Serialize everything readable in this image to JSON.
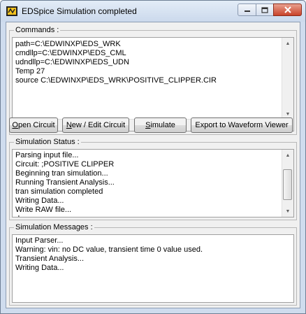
{
  "window": {
    "title": "EDSpice Simulation completed"
  },
  "commands": {
    "label": "Commands :",
    "lines": [
      "path=C:\\EDWINXP\\EDS_WRK",
      "cmdllp=C:\\EDWINXP\\EDS_CML",
      "udndllp=C:\\EDWINXP\\EDS_UDN",
      "Temp 27",
      "source C:\\EDWINXP\\EDS_WRK\\POSITIVE_CLIPPER.CIR"
    ]
  },
  "buttons": {
    "open_circuit": "Open Circuit",
    "new_edit_circuit": "New / Edit Circuit",
    "simulate": "Simulate",
    "export": "Export to Waveform Viewer"
  },
  "status": {
    "label": "Simulation Status :",
    "lines": [
      "Parsing input file...",
      "Circuit: ;POSITIVE CLIPPER",
      "Beginning tran simulation...",
      "Running Transient Analysis...",
      "tran simulation completed",
      "Writing Data...",
      "Write RAW file...",
      "done"
    ]
  },
  "messages": {
    "label": "Simulation Messages :",
    "lines": [
      "Input Parser...",
      "Warning: vin: no DC value, transient time 0 value used.",
      "Transient Analysis...",
      "Writing Data..."
    ]
  }
}
